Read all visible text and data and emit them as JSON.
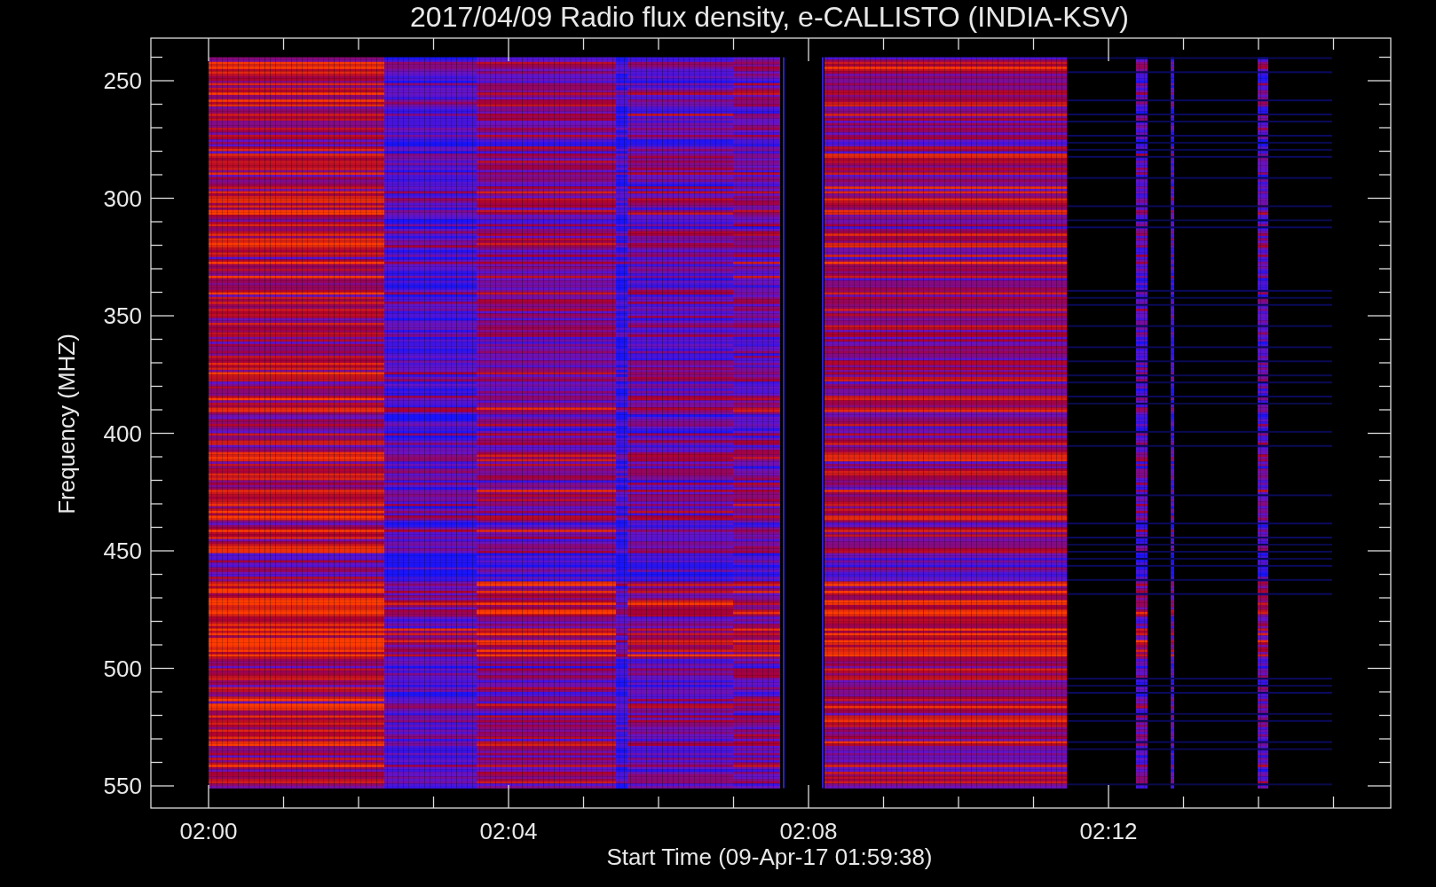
{
  "title": "2017/04/09  Radio flux density, e-CALLISTO (INDIA-KSV)",
  "y_axis": {
    "label": "Frequency (MHZ)",
    "ticks": [
      "250",
      "300",
      "350",
      "400",
      "450",
      "500",
      "550"
    ]
  },
  "x_axis": {
    "label": "Start Time (09-Apr-17 01:59:38)",
    "ticks": [
      "02:00",
      "02:04",
      "02:08",
      "02:12"
    ]
  }
}
